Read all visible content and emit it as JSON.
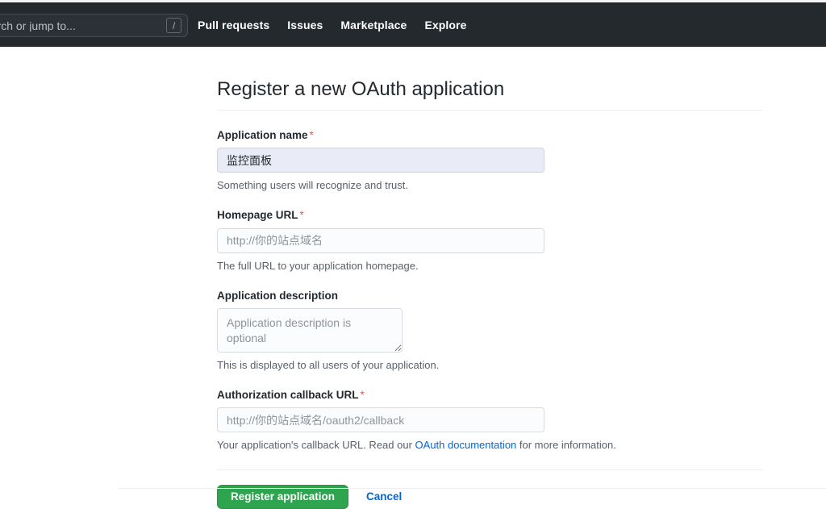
{
  "header": {
    "search": {
      "placeholder": "earch or jump to...",
      "shortcut_key": "/"
    },
    "nav_items": [
      {
        "label": "Pull requests"
      },
      {
        "label": "Issues"
      },
      {
        "label": "Marketplace"
      },
      {
        "label": "Explore"
      }
    ],
    "background_color": "#24292e"
  },
  "page": {
    "title": "Register a new OAuth application"
  },
  "form": {
    "fields": [
      {
        "label": "Application name",
        "required": true,
        "required_marker": "*",
        "value": "监控面板",
        "placeholder": "",
        "help": "Something users will recognize and trust.",
        "focused": true
      },
      {
        "label": "Homepage URL",
        "required": true,
        "required_marker": "*",
        "value": "",
        "placeholder": "http://你的站点域名",
        "help": "The full URL to your application homepage.",
        "focused": false
      },
      {
        "label": "Application description",
        "required": false,
        "required_marker": "",
        "value": "",
        "placeholder": "Application description is optional",
        "help": "This is displayed to all users of your application.",
        "focused": false
      },
      {
        "label": "Authorization callback URL",
        "required": true,
        "required_marker": "*",
        "value": "",
        "placeholder": "http://你的站点域名/oauth2/callback",
        "help_prefix": "Your application's callback URL. Read our ",
        "help_link": "OAuth documentation",
        "help_suffix": " for more information.",
        "focused": false
      }
    ],
    "submit_label": "Register application",
    "cancel_label": "Cancel",
    "submit_color": "#2ea44f",
    "link_color": "#0366d6",
    "required_color": "#d15e5e"
  }
}
